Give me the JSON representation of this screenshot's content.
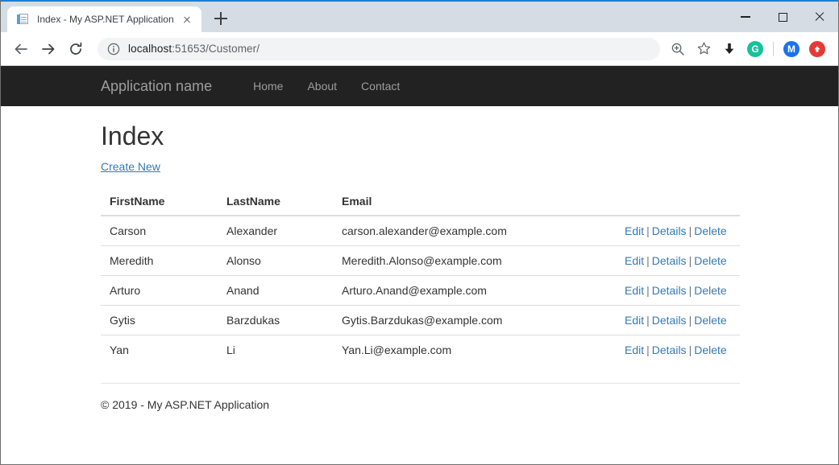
{
  "browser": {
    "tab": {
      "title": "Index - My ASP.NET Application",
      "favicon": "page-icon",
      "close_icon": "close-icon"
    },
    "new_tab_icon": "plus-icon",
    "window_controls": {
      "minimize": "minimize-icon",
      "maximize": "maximize-icon",
      "close": "close-icon"
    },
    "toolbar": {
      "back_icon": "back-arrow-icon",
      "forward_icon": "forward-arrow-icon",
      "reload_icon": "reload-icon",
      "site_info_icon": "info-circle-icon",
      "url_host": "localhost",
      "url_path": ":51653/Customer/",
      "url_full": "localhost:51653/Customer/",
      "icons": [
        {
          "name": "zoom-icon",
          "glyph": "search-plus"
        },
        {
          "name": "bookmark-star-icon",
          "glyph": "star"
        },
        {
          "name": "download-icon",
          "glyph": "down-arrow"
        },
        {
          "name": "grammarly-extension-icon",
          "label": "G",
          "color": "#15c39a"
        },
        {
          "name": "profile-avatar-icon",
          "label": "M",
          "color": "#1a73e8"
        },
        {
          "name": "update-icon",
          "glyph": "up-arrow",
          "color": "#e53935"
        }
      ]
    }
  },
  "site": {
    "navbar": {
      "brand": "Application name",
      "links": [
        {
          "label": "Home"
        },
        {
          "label": "About"
        },
        {
          "label": "Contact"
        }
      ]
    },
    "page": {
      "heading": "Index",
      "create_link": "Create New"
    },
    "table": {
      "headers": [
        "FirstName",
        "LastName",
        "Email"
      ],
      "actions": {
        "edit": "Edit",
        "details": "Details",
        "delete": "Delete",
        "separator": "|"
      },
      "rows": [
        {
          "first_name": "Carson",
          "last_name": "Alexander",
          "email": "carson.alexander@example.com"
        },
        {
          "first_name": "Meredith",
          "last_name": "Alonso",
          "email": "Meredith.Alonso@example.com"
        },
        {
          "first_name": "Arturo",
          "last_name": "Anand",
          "email": "Arturo.Anand@example.com"
        },
        {
          "first_name": "Gytis",
          "last_name": "Barzdukas",
          "email": "Gytis.Barzdukas@example.com"
        },
        {
          "first_name": "Yan",
          "last_name": "Li",
          "email": "Yan.Li@example.com"
        }
      ]
    },
    "footer": {
      "copyright": "© 2019 - My ASP.NET Application"
    }
  },
  "colors": {
    "navbar_bg": "#222222",
    "link": "#337ab7",
    "tabstrip_bg": "#d6dce3",
    "accent": "#1a7fd4"
  }
}
